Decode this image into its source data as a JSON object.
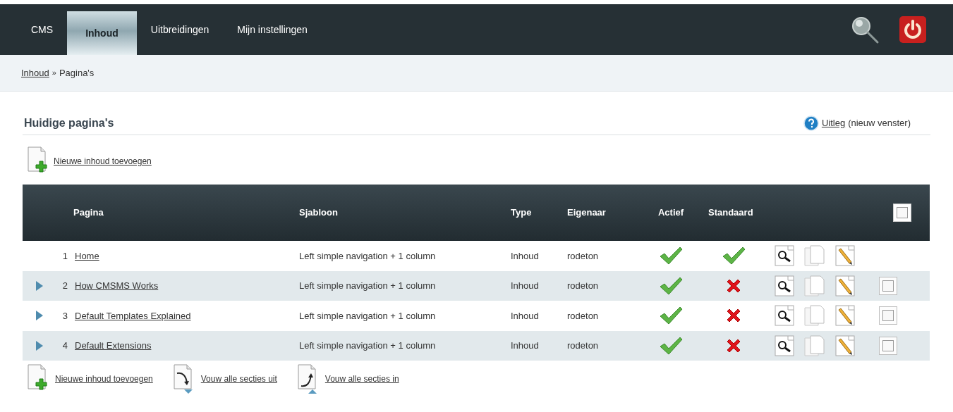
{
  "nav": {
    "tabs": [
      {
        "label": "CMS",
        "selected": false
      },
      {
        "label": "Inhoud",
        "selected": true
      },
      {
        "label": "Uitbreidingen",
        "selected": false
      },
      {
        "label": "Mijn instellingen",
        "selected": false
      }
    ]
  },
  "breadcrumb": {
    "link": "Inhoud",
    "separator": "»",
    "current": "Pagina's"
  },
  "heading": "Huidige pagina's",
  "help": {
    "link": "Uitleg",
    "note": "(nieuw venster)"
  },
  "add_link": "Nieuwe inhoud toevoegen",
  "table": {
    "columns": [
      "Pagina",
      "Sjabloon",
      "Type",
      "Eigenaar",
      "Actief",
      "Standaard"
    ],
    "select_all": {
      "checked": false
    },
    "rows": [
      {
        "number": "1",
        "title": "Home",
        "template": "Left simple navigation + 1 column",
        "type": "Inhoud",
        "owner": "rodeton",
        "active": true,
        "default": true,
        "expandable": false
      },
      {
        "number": "2",
        "title": "How CMSMS Works",
        "template": "Left simple navigation + 1 column",
        "type": "Inhoud",
        "owner": "rodeton",
        "active": true,
        "default": false,
        "expandable": true,
        "checked": false
      },
      {
        "number": "3",
        "title": "Default Templates Explained",
        "template": "Left simple navigation + 1 column",
        "type": "Inhoud",
        "owner": "rodeton",
        "active": true,
        "default": false,
        "expandable": true,
        "checked": false
      },
      {
        "number": "4",
        "title": "Default Extensions",
        "template": "Left simple navigation + 1 column",
        "type": "Inhoud",
        "owner": "rodeton",
        "active": true,
        "default": false,
        "expandable": true,
        "checked": false
      }
    ]
  },
  "footer_links": [
    {
      "kind": "add",
      "label": "Nieuwe inhoud toevoegen"
    },
    {
      "kind": "expand",
      "label": "Vouw alle secties uit"
    },
    {
      "kind": "collapse",
      "label": "Vouw alle secties in"
    }
  ]
}
